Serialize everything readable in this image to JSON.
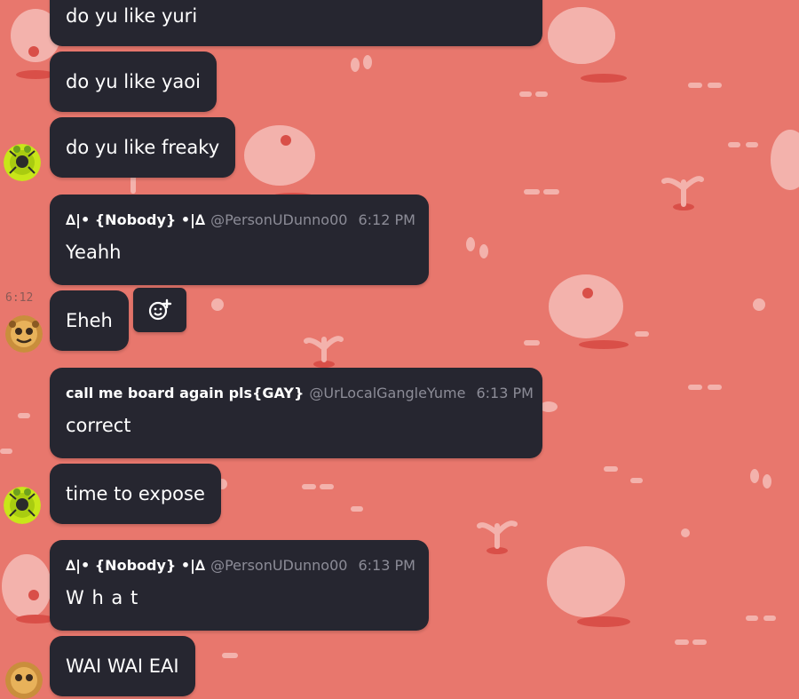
{
  "messages": [
    {
      "text": "do yu like yuri"
    },
    {
      "text": "do yu like yaoi"
    },
    {
      "text": "do yu like freaky"
    },
    {
      "author": "∆|• {Nobody} •|∆",
      "handle": "@PersonUDunno00",
      "time": "6:12 PM",
      "text": "Yeahh"
    },
    {
      "text": "Eheh",
      "hover_time": "6:12"
    },
    {
      "author": "call me board again pls{GAY}",
      "handle": "@UrLocalGangleYume",
      "time": "6:13 PM",
      "text": "correct"
    },
    {
      "text": "time to expose"
    },
    {
      "author": "∆|• {Nobody} •|∆",
      "handle": "@PersonUDunno00",
      "time": "6:13 PM",
      "text": "W h a t"
    },
    {
      "text": "WAI WAI EAI"
    }
  ],
  "actions": {
    "add_reaction_icon": "add-reaction-icon"
  },
  "colors": {
    "background": "#e8776d",
    "bubble": "#262630",
    "muted_text": "#8c8c97",
    "avatar_green": "#c8e619"
  }
}
